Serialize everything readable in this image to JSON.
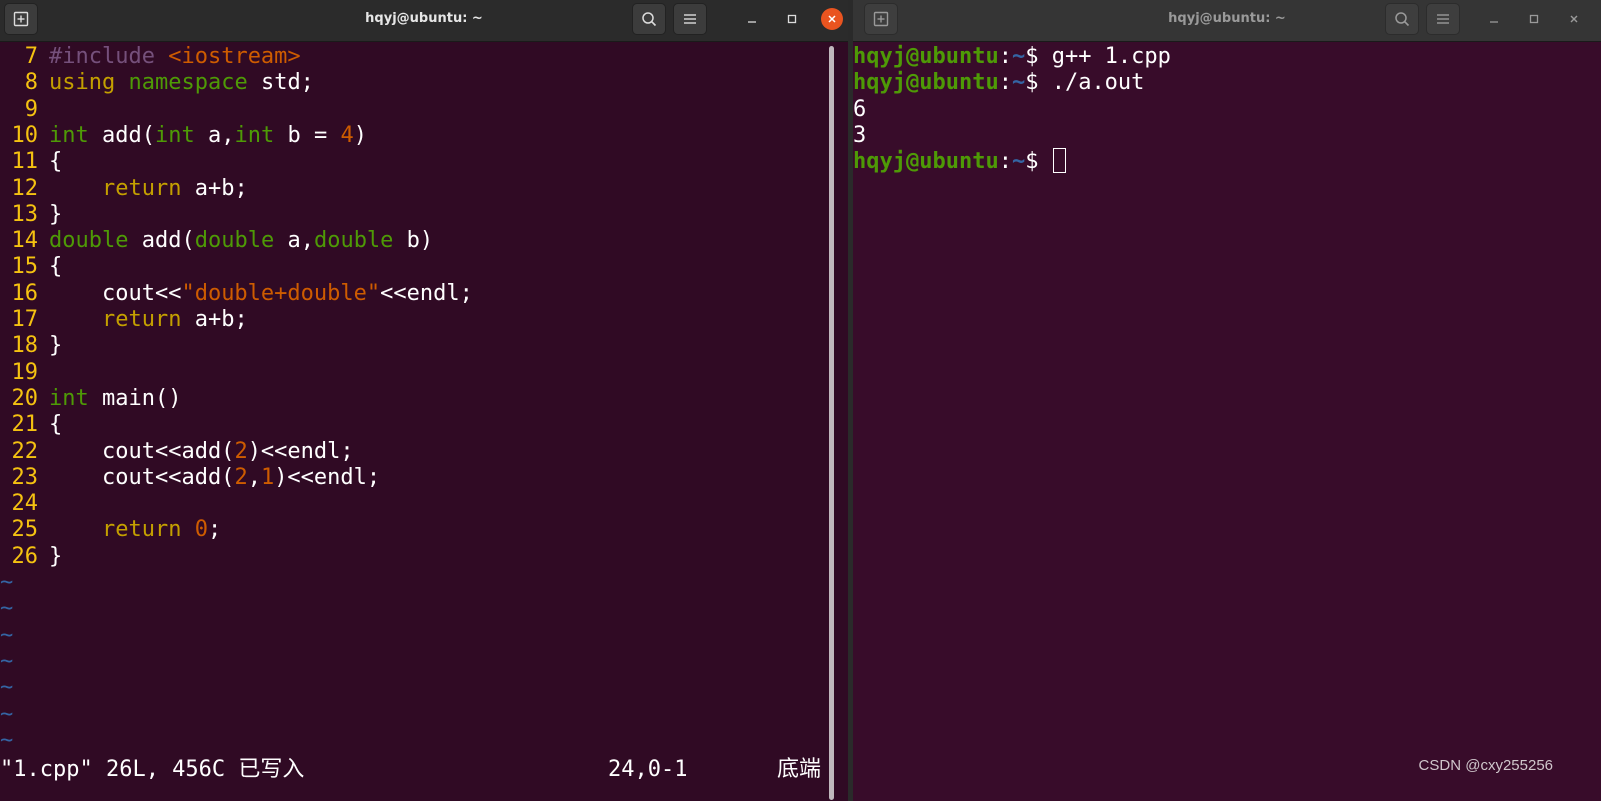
{
  "colors": {
    "line_number": "#f5c211",
    "keyword_type": "#4e9a06",
    "keyword_control": "#c4a000",
    "string": "#ce5c00",
    "preprocessor": "#75507b",
    "number": "#ce5c00",
    "tilde": "#3465a4",
    "prompt_user": "#4e9a06",
    "prompt_path": "#3465a4",
    "close_button": "#e95420"
  },
  "left_window": {
    "title": "hqyj@ubuntu: ~",
    "icons": [
      "new-tab-icon",
      "search-icon",
      "hamburger-menu-icon",
      "minimize-icon",
      "maximize-icon",
      "close-icon"
    ],
    "code_lines": [
      {
        "num": "7",
        "segs": [
          [
            "#include ",
            "preprocessor"
          ],
          [
            "<iostream>",
            "string"
          ]
        ]
      },
      {
        "num": "8",
        "segs": [
          [
            "using ",
            "keyword_control"
          ],
          [
            "namespace",
            "keyword_type"
          ],
          [
            " std;",
            "plain"
          ]
        ]
      },
      {
        "num": "9",
        "segs": []
      },
      {
        "num": "10",
        "segs": [
          [
            "int",
            "keyword_type"
          ],
          [
            " add(",
            "plain"
          ],
          [
            "int",
            "keyword_type"
          ],
          [
            " a,",
            "plain"
          ],
          [
            "int",
            "keyword_type"
          ],
          [
            " b = ",
            "plain"
          ],
          [
            "4",
            "number"
          ],
          [
            ")",
            "plain"
          ]
        ]
      },
      {
        "num": "11",
        "segs": [
          [
            "{",
            "plain"
          ]
        ]
      },
      {
        "num": "12",
        "segs": [
          [
            "    ",
            "plain"
          ],
          [
            "return",
            "keyword_control"
          ],
          [
            " a+b;",
            "plain"
          ]
        ]
      },
      {
        "num": "13",
        "segs": [
          [
            "}",
            "plain"
          ]
        ]
      },
      {
        "num": "14",
        "segs": [
          [
            "double",
            "keyword_type"
          ],
          [
            " add(",
            "plain"
          ],
          [
            "double",
            "keyword_type"
          ],
          [
            " a,",
            "plain"
          ],
          [
            "double",
            "keyword_type"
          ],
          [
            " b)",
            "plain"
          ]
        ]
      },
      {
        "num": "15",
        "segs": [
          [
            "{",
            "plain"
          ]
        ]
      },
      {
        "num": "16",
        "segs": [
          [
            "    cout<<",
            "plain"
          ],
          [
            "\"double+double\"",
            "string"
          ],
          [
            "<<endl;",
            "plain"
          ]
        ]
      },
      {
        "num": "17",
        "segs": [
          [
            "    ",
            "plain"
          ],
          [
            "return",
            "keyword_control"
          ],
          [
            " a+b;",
            "plain"
          ]
        ]
      },
      {
        "num": "18",
        "segs": [
          [
            "}",
            "plain"
          ]
        ]
      },
      {
        "num": "19",
        "segs": []
      },
      {
        "num": "20",
        "segs": [
          [
            "int",
            "keyword_type"
          ],
          [
            " main()",
            "plain"
          ]
        ]
      },
      {
        "num": "21",
        "segs": [
          [
            "{",
            "plain"
          ]
        ]
      },
      {
        "num": "22",
        "segs": [
          [
            "    cout<<add(",
            "plain"
          ],
          [
            "2",
            "number"
          ],
          [
            ")<<endl;",
            "plain"
          ]
        ]
      },
      {
        "num": "23",
        "segs": [
          [
            "    cout<<add(",
            "plain"
          ],
          [
            "2",
            "number"
          ],
          [
            ",",
            "plain"
          ],
          [
            "1",
            "number"
          ],
          [
            ")<<endl;",
            "plain"
          ]
        ]
      },
      {
        "num": "24",
        "segs": []
      },
      {
        "num": "25",
        "segs": [
          [
            "    ",
            "plain"
          ],
          [
            "return",
            "keyword_control"
          ],
          [
            " ",
            "plain"
          ],
          [
            "0",
            "number"
          ],
          [
            ";",
            "plain"
          ]
        ]
      },
      {
        "num": "26",
        "segs": [
          [
            "}",
            "plain"
          ]
        ]
      }
    ],
    "tildes": [
      "~",
      "~",
      "~",
      "~",
      "~",
      "~",
      "~"
    ],
    "status": {
      "message": "\"1.cpp\" 26L, 456C 已写入",
      "position": "24,0-1",
      "scroll": "底端"
    }
  },
  "right_window": {
    "title": "hqyj@ubuntu: ~",
    "icons": [
      "new-tab-icon",
      "search-icon",
      "hamburger-menu-icon",
      "minimize-icon",
      "maximize-icon",
      "close-icon"
    ],
    "prompt": {
      "user": "hqyj@ubuntu",
      "sep": ":",
      "path": "~",
      "symbol": "$ "
    },
    "lines": [
      {
        "type": "prompt",
        "command": "g++ 1.cpp"
      },
      {
        "type": "prompt",
        "command": "./a.out"
      },
      {
        "type": "output",
        "text": "6"
      },
      {
        "type": "output",
        "text": "3"
      },
      {
        "type": "prompt",
        "command": "",
        "cursor": true
      }
    ]
  },
  "watermark": "CSDN @cxy255256"
}
